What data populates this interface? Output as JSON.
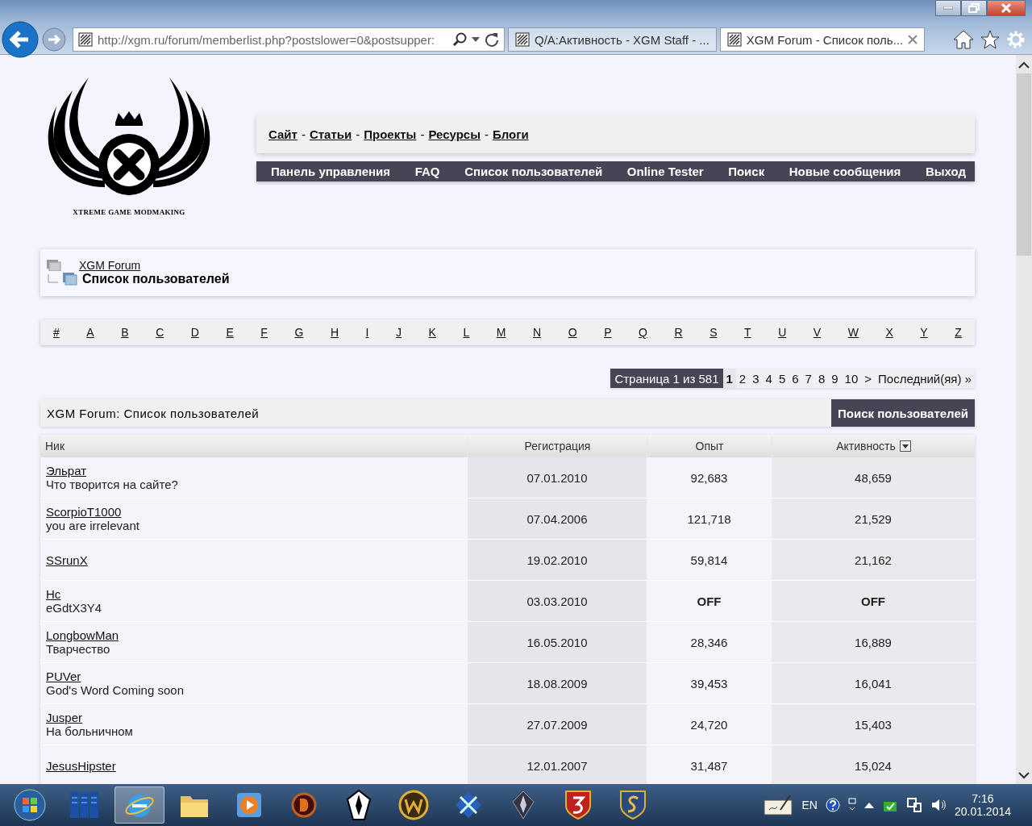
{
  "browser": {
    "address": "http://xgm.ru/forum/memberlist.php?postslower=0&postsupper:",
    "tabs": [
      {
        "title": "Q/A:Активность - XGM Staff - ...",
        "selected": false
      },
      {
        "title": "XGM Forum - Список поль...",
        "selected": true
      }
    ]
  },
  "logo": {
    "caption": "XTREME GAME MODMAKING"
  },
  "site_links": [
    {
      "label": "Сайт",
      "separator": "-"
    },
    {
      "label": "Статьи",
      "separator": "-"
    },
    {
      "label": "Проекты",
      "separator": "-"
    },
    {
      "label": "Ресурсы",
      "separator": "-"
    },
    {
      "label": "Блоги"
    }
  ],
  "main_nav": [
    "Панель управления",
    "FAQ",
    "Список пользователей",
    "Online Tester",
    "Поиск",
    "Новые сообщения",
    "Выход"
  ],
  "breadcrumb": {
    "parent": "XGM Forum",
    "current": "Список пользователей"
  },
  "letters": [
    "#",
    "A",
    "B",
    "C",
    "D",
    "E",
    "F",
    "G",
    "H",
    "I",
    "J",
    "K",
    "L",
    "M",
    "N",
    "O",
    "P",
    "Q",
    "R",
    "S",
    "T",
    "U",
    "V",
    "W",
    "X",
    "Y",
    "Z"
  ],
  "pagination": {
    "label": "Страница 1 из 581",
    "pages": [
      {
        "label": "1",
        "selected": true
      },
      {
        "label": "2",
        "selected": false
      },
      {
        "label": "3",
        "selected": false
      },
      {
        "label": "4",
        "selected": false
      },
      {
        "label": "5",
        "selected": false
      },
      {
        "label": "6",
        "selected": false
      },
      {
        "label": "7",
        "selected": false
      },
      {
        "label": "8",
        "selected": false
      },
      {
        "label": "9",
        "selected": false
      },
      {
        "label": "10",
        "selected": false
      }
    ],
    "next": ">",
    "last": "Последний(яя) »"
  },
  "table": {
    "title": "XGM Forum: Список пользователей",
    "search_button": "Поиск пользователей",
    "columns": [
      {
        "label": "Ник",
        "sorted": false
      },
      {
        "label": "Регистрация",
        "sorted": false
      },
      {
        "label": "Опыт",
        "sorted": false
      },
      {
        "label": "Активность",
        "sorted": true
      }
    ],
    "rows": [
      {
        "name": "Эльрат",
        "status": "Что творится на сайте?",
        "registered": "07.01.2010",
        "experience": "92,683",
        "activity": "48,659",
        "stats_hidden": false
      },
      {
        "name": "ScorpioT1000",
        "status": "you are irrelevant",
        "registered": "07.04.2006",
        "experience": "121,718",
        "activity": "21,529",
        "stats_hidden": false
      },
      {
        "name": "SSrunX",
        "registered": "19.02.2010",
        "experience": "59,814",
        "activity": "21,162",
        "stats_hidden": false
      },
      {
        "name": "Hc",
        "status": "eGdtX3Y4",
        "registered": "03.03.2010",
        "experience": "OFF",
        "activity": "OFF",
        "stats_hidden": true
      },
      {
        "name": "LongbowMan",
        "status": "Тварчество",
        "registered": "16.05.2010",
        "experience": "28,346",
        "activity": "16,889",
        "stats_hidden": false
      },
      {
        "name": "PUVer",
        "status": "God's Word Coming soon",
        "registered": "18.08.2009",
        "experience": "39,453",
        "activity": "16,041",
        "stats_hidden": false
      },
      {
        "name": "Jusper",
        "status": "На больничном",
        "registered": "27.07.2009",
        "experience": "24,720",
        "activity": "15,403",
        "stats_hidden": false
      },
      {
        "name": "JesusHipster",
        "registered": "12.01.2007",
        "experience": "31,487",
        "activity": "15,024",
        "stats_hidden": false
      }
    ]
  },
  "taskbar": {
    "buttons": [
      {
        "selected": false
      },
      {
        "selected": false
      },
      {
        "selected": true
      },
      {
        "selected": false
      },
      {
        "selected": false
      },
      {
        "selected": false
      },
      {
        "selected": false
      },
      {
        "selected": false
      },
      {
        "selected": false
      },
      {
        "selected": false
      },
      {
        "selected": false
      },
      {
        "selected": false
      }
    ],
    "language": "EN",
    "time": "7:16",
    "date": "20.01.2014"
  }
}
